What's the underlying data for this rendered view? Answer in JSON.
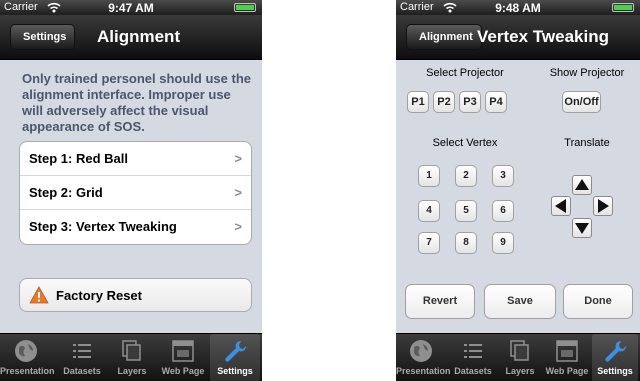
{
  "left": {
    "status": {
      "carrier": "Carrier",
      "time": "9:47 AM"
    },
    "nav": {
      "back": "Settings",
      "title": "Alignment"
    },
    "notice": "Only trained personel should use the alignment interface. Improper use will adversely affect the visual appearance of SOS.",
    "steps": [
      "Step 1:  Red Ball",
      "Step 2:  Grid",
      "Step 3:  Vertex Tweaking"
    ],
    "reset": "Factory Reset"
  },
  "right": {
    "status": {
      "carrier": "Carrier",
      "time": "9:48 AM"
    },
    "nav": {
      "back": "Alignment",
      "title": "Vertex Tweaking"
    },
    "select_projector": "Select Projector",
    "show_projector": "Show Projector",
    "projectors": [
      "P1",
      "P2",
      "P3",
      "P4"
    ],
    "on_off": "On/Off",
    "select_vertex": "Select Vertex",
    "translate": "Translate",
    "vertices": [
      "1",
      "2",
      "3",
      "4",
      "5",
      "6",
      "7",
      "8",
      "9"
    ],
    "actions": {
      "revert": "Revert",
      "save": "Save",
      "done": "Done"
    }
  },
  "tabs": [
    "Presentation",
    "Datasets",
    "Layers",
    "Web Page",
    "Settings"
  ],
  "icons": {
    "wifi": "wifi-icon",
    "battery": "battery-icon",
    "chevron": "chevron-right-icon",
    "warning": "warning-icon",
    "globe": "globe-icon",
    "list": "list-icon",
    "layers": "layers-icon",
    "webpage": "webpage-icon",
    "wrench": "wrench-icon",
    "arrows": [
      "arrow-up-icon",
      "arrow-left-icon",
      "arrow-right-icon",
      "arrow-down-icon"
    ]
  },
  "colors": {
    "accent_battery": "#4bd14b",
    "notice_text": "#4c566c",
    "warning": "#e8792a",
    "settings_icon": "#3f8fe0"
  }
}
